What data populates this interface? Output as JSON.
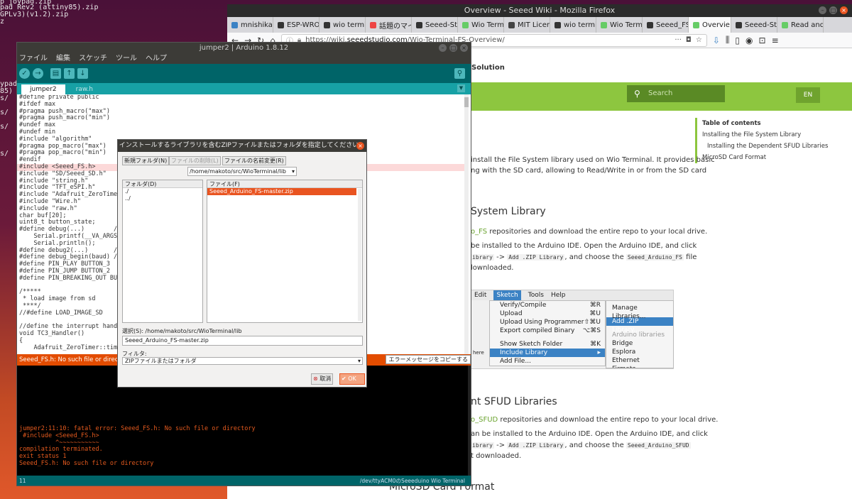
{
  "terminal": {
    "lines": [
      "p joypad.zip",
      "pad Rev2 (attiny85).zip",
      "GPLv3)(v1.2).zip",
      "z",
      "ypad",
      "85)",
      "s/",
      "s/",
      "s/",
      "s/"
    ]
  },
  "firefox": {
    "window_title": "Overview - Seeed Wiki - Mozilla Firefox",
    "tabs": [
      "mnishikaw",
      "ESP-WROC",
      "wio termin",
      "話題のマイ",
      "Seeed-Stu",
      "Wio Termi",
      "MIT Licens",
      "wio termin",
      "Wio Termi",
      "Seeed_FS.h",
      "Overvie",
      "Seeed-Stu",
      "Read and V"
    ],
    "active_tab_index": 10,
    "url_prefix": "https://wiki.",
    "url_domain": "seeedstudio.com",
    "url_path": "/Wio-Terminal-FS-Overview/"
  },
  "wiki": {
    "header_text": "Solution",
    "search_placeholder": "Search",
    "lang": "EN",
    "toc_title": "Table of contents",
    "toc_items": [
      "Installing the File System Library",
      "Installing the Dependent SFUD Libraries",
      "MicroSD Card Format"
    ],
    "intro_line1": "install the File System library used on Wio Terminal. It provides basic",
    "intro_line2": "ng with the SD card, allowing to Read/Write in or from the SD card",
    "h2_fs": "System Library",
    "fs_link": "o_FS",
    "fs_p1": " repositories and download the entire repo to your local drive.",
    "fs_p2": "be installed to the Arduino IDE. Open the Arduino IDE, and click",
    "fs_p3_code1": "ibrary",
    "fs_p3_arrow": "->",
    "fs_p3_code2": "Add .ZIP Library",
    "fs_p3_mid": ", and choose the",
    "fs_p3_code3": "Seeed_Arduino_FS",
    "fs_p3_end": "file",
    "fs_p4": "lownloaded.",
    "h2_sfud": "nt SFUD Libraries",
    "sfud_link": "o_SFUD",
    "sfud_p1": " repositories and download the entire repo to your local drive.",
    "sfud_p2": "an be installed to the Arduino IDE. Open the Arduino IDE, and click",
    "sfud_p3_code1": "ibrary",
    "sfud_p3_arrow": "->",
    "sfud_p3_code2": "Add .ZIP Library",
    "sfud_p3_mid": ", and choose the",
    "sfud_p3_code3": "Seeed_Arduino_SFUD",
    "sfud_p4": "t downloaded.",
    "h2_microsd": "MicroSD Card Format",
    "here_text": "here"
  },
  "menu_shot": {
    "menubar": [
      "Edit",
      "Sketch",
      "Tools",
      "Help"
    ],
    "sketch_items": [
      {
        "label": "Verify/Compile",
        "key": "⌘R"
      },
      {
        "label": "Upload",
        "key": "⌘U"
      },
      {
        "label": "Upload Using Programmer",
        "key": "⇧⌘U"
      },
      {
        "label": "Export compiled Binary",
        "key": "⌥⌘S"
      },
      {
        "label": "Show Sketch Folder",
        "key": "⌘K"
      },
      {
        "label": "Include Library",
        "key": "▸"
      },
      {
        "label": "Add File...",
        "key": ""
      }
    ],
    "include_items": [
      "Manage Libraries...",
      "Add .ZIP Library...",
      "Arduino libraries",
      "Bridge",
      "Esplora",
      "Ethernet",
      "Firmata"
    ]
  },
  "arduino": {
    "window_title": "jumper2 | Arduino 1.8.12",
    "menus": [
      "ファイル",
      "編集",
      "スケッチ",
      "ツール",
      "ヘルプ"
    ],
    "tabs": [
      "jumper2",
      "raw.h"
    ],
    "code_lines": [
      "#define private public",
      "#ifdef max",
      "#pragma push_macro(\"max\")",
      "#pragma push_macro(\"min\")",
      "#undef max",
      "#undef min",
      "#include \"algorithm\"",
      "#pragma pop_macro(\"max\")",
      "#pragma pop_macro(\"min\")",
      "#endif",
      "#include <Seeed_FS.h>",
      "#include \"SD/Seeed_SD.h\"",
      "#include \"string.h\"",
      "#include \"TFT_eSPI.h\"",
      "#include \"Adafruit_ZeroTimer",
      "#include \"Wire.h\"",
      "#include \"raw.h\"",
      "char buf[20];",
      "uint8_t button_state;",
      "#define debug(...)        //",
      "    Serial.printf(__VA_ARGS_",
      "    Serial.println();",
      "#define debug2(...)       //",
      "#define debug_begin(baud) //",
      "#define PIN_PLAY BUTTON_3",
      "#define PIN_JUMP BUTTON_2",
      "#define PIN_BREAKING_OUT BUTT",
      "",
      "/*****",
      " * load image from sd",
      " ****/",
      "//#define LOAD_IMAGE_SD",
      "",
      "//define the interrupt handle",
      "void TC3_Handler()",
      "{",
      "    Adafruit_ZeroTimer::time"
    ],
    "highlight_line": 10,
    "error_bar": "Seeed_FS.h: No such file or directo",
    "copy_button": "エラーメッセージをコピーする",
    "console_lines": [
      "jumper2:11:10: fatal error: Seeed_FS.h: No such file or directory",
      " #include <Seeed_FS.h>",
      "          ^~~~~~~~~~~~",
      "compilation terminated.",
      "exit status 1",
      "Seeed_FS.h: No such file or directory"
    ],
    "status_line": "11",
    "status_port": "/dev/ttyACM0のSeeeduino Wio Terminal"
  },
  "dialog": {
    "title": "インストールするライブラリを含むZIPファイルまたはフォルダを指定してください。",
    "btn_new_folder": "新規フォルダ(N)",
    "btn_delete": "ファイルの削除(L)",
    "btn_rename": "ファイルの名前変更(R)",
    "path": "/home/makoto/src/WioTerminal/lib",
    "folder_header": "フォルダ(D)",
    "file_header": "ファイル(F)",
    "folders": [
      "./",
      "../"
    ],
    "files": [
      "Seeed_Arduino_FS-master.zip"
    ],
    "selection_label": "選択(S): /home/makoto/src/WioTerminal/lib",
    "selection_value": "Seeed_Arduino_FS-master.zip",
    "filter_label": "フィルタ:",
    "filter_value": "ZIPファイルまたはフォルダ",
    "cancel": "取消",
    "ok": "OK"
  }
}
